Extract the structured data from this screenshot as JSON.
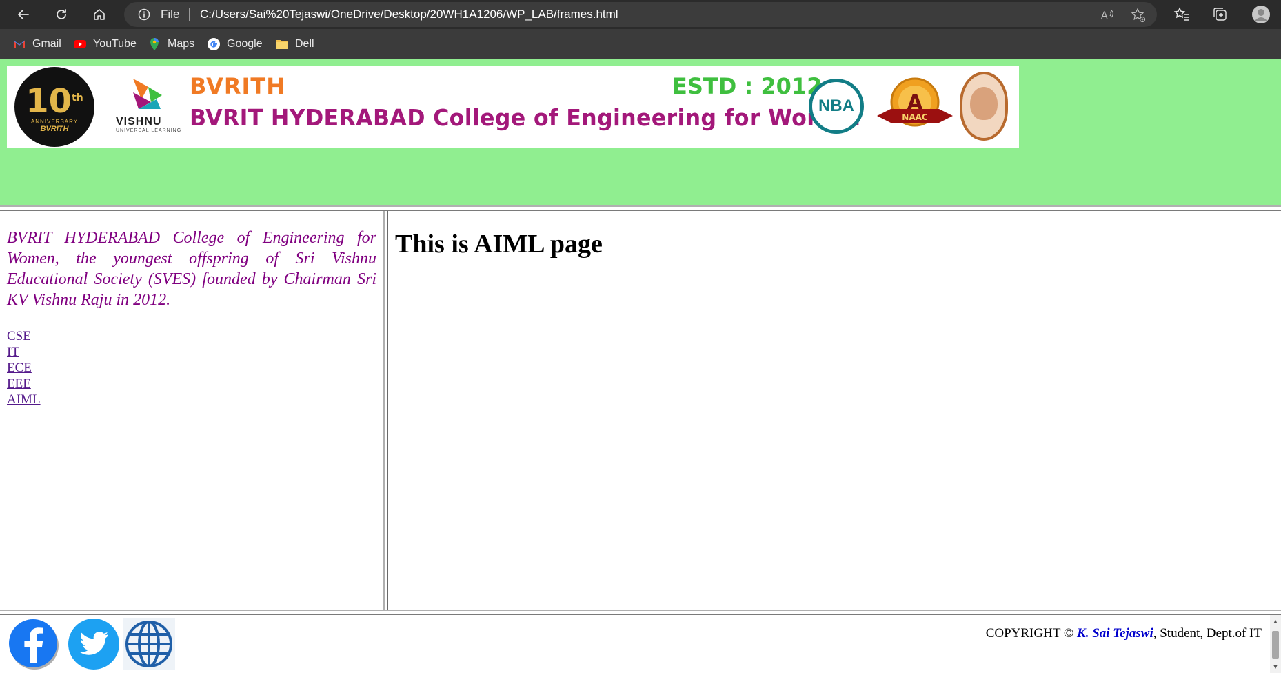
{
  "browser": {
    "file_label": "File",
    "url": "C:/Users/Sai%20Tejaswi/OneDrive/Desktop/20WH1A1206/WP_LAB/frames.html",
    "bookmarks": [
      {
        "label": "Gmail",
        "icon": "gmail-icon"
      },
      {
        "label": "YouTube",
        "icon": "youtube-icon"
      },
      {
        "label": "Maps",
        "icon": "maps-icon"
      },
      {
        "label": "Google",
        "icon": "google-icon"
      },
      {
        "label": "Dell",
        "icon": "folder-icon"
      }
    ]
  },
  "banner": {
    "anniversary": {
      "number": "10",
      "suffix": "th",
      "line": "ANNIVERSARY",
      "name": "BVRITH"
    },
    "vishnu": {
      "name": "VISHNU",
      "tagline": "UNIVERSAL LEARNING"
    },
    "short_name": "BVRITH",
    "established": "ESTD : 2012",
    "full_name": "BVRIT HYDERABAD College of Engineering for Women",
    "nba": "NBA",
    "naac": {
      "grade": "A",
      "label": "NAAC"
    }
  },
  "left": {
    "intro": "BVRIT HYDERABAD College of Engineering for Women, the youngest offspring of Sri Vishnu Educational Society (SVES) founded by Chairman Sri KV Vishnu Raju in 2012.",
    "links": [
      "CSE",
      "IT",
      "ECE",
      "EEE",
      "AIML"
    ]
  },
  "main": {
    "heading": "This is AIML page"
  },
  "footer": {
    "copyright_prefix": "COPYRIGHT © ",
    "author": "K. Sai Tejaswi",
    "copyright_suffix": ", Student, Dept.of IT",
    "social": [
      "facebook-icon",
      "twitter-icon",
      "globe-icon"
    ]
  },
  "colors": {
    "top_frame_bg": "#90ee90",
    "intro_text": "#800080",
    "banner_title": "#a3187a",
    "banner_short": "#f07a24",
    "banner_estd": "#3fbf3f",
    "author": "#0000cc"
  }
}
